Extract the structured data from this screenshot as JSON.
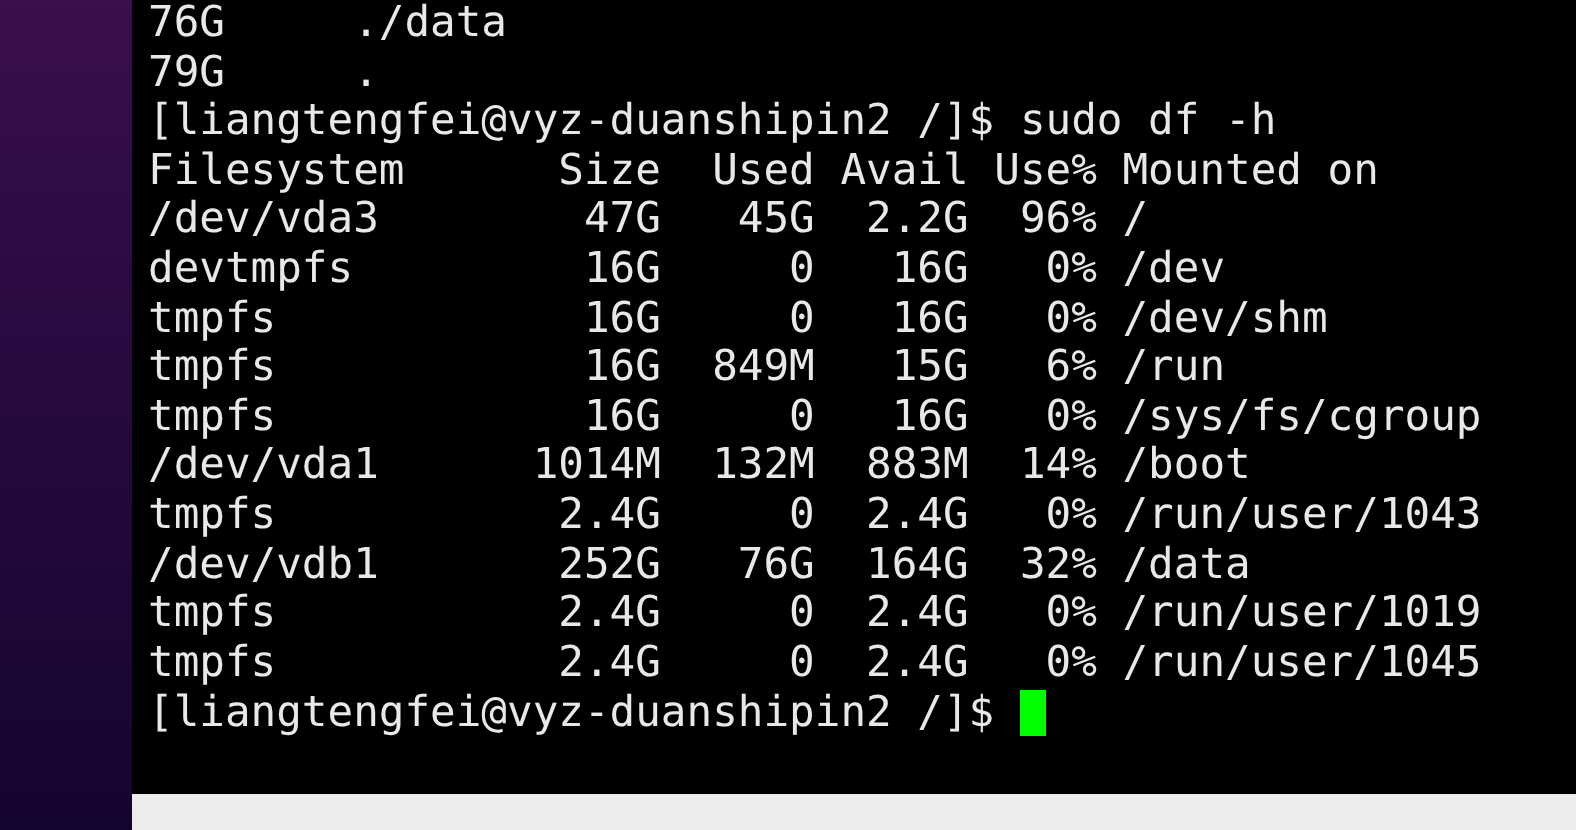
{
  "terminal": {
    "lines": [
      "76G     ./data",
      "79G     .",
      "[liangtengfei@vyz-duanshipin2 /]$ sudo df -h",
      "Filesystem      Size  Used Avail Use% Mounted on",
      "/dev/vda3        47G   45G  2.2G  96% /",
      "devtmpfs         16G     0   16G   0% /dev",
      "tmpfs            16G     0   16G   0% /dev/shm",
      "tmpfs            16G  849M   15G   6% /run",
      "tmpfs            16G     0   16G   0% /sys/fs/cgroup",
      "/dev/vda1      1014M  132M  883M  14% /boot",
      "tmpfs           2.4G     0  2.4G   0% /run/user/1043",
      "/dev/vdb1       252G   76G  164G  32% /data",
      "tmpfs           2.4G     0  2.4G   0% /run/user/1019",
      "tmpfs           2.4G     0  2.4G   0% /run/user/1045"
    ],
    "prompt": "[liangtengfei@vyz-duanshipin2 /]$ "
  }
}
